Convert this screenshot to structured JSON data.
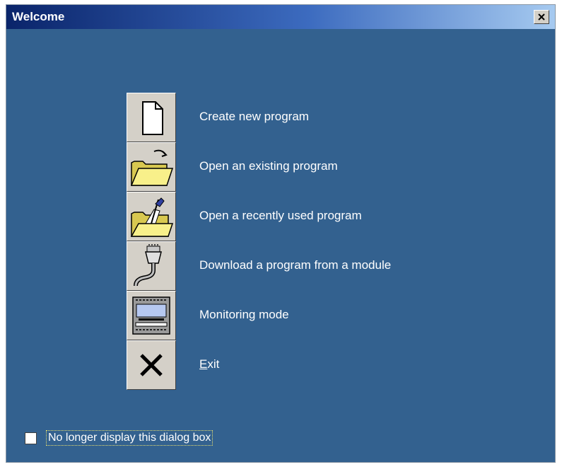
{
  "window": {
    "title": "Welcome"
  },
  "menu": {
    "items": [
      {
        "label": "Create new program",
        "icon": "new-document-icon"
      },
      {
        "label": "Open an existing program",
        "icon": "open-folder-icon"
      },
      {
        "label": "Open a recently used program",
        "icon": "recent-folder-icon"
      },
      {
        "label": "Download a program from a module",
        "icon": "download-cable-icon"
      },
      {
        "label": "Monitoring mode",
        "icon": "monitor-module-icon"
      },
      {
        "label_accel": "E",
        "label_rest": "xit",
        "icon": "exit-x-icon"
      }
    ]
  },
  "footer": {
    "checkbox_label": "No longer display this dialog box",
    "checked": false
  },
  "colors": {
    "background": "#33618f",
    "title_bar_start": "#0a246a",
    "button_face": "#d4d0c8",
    "folder_yellow": "#f8f08a"
  }
}
